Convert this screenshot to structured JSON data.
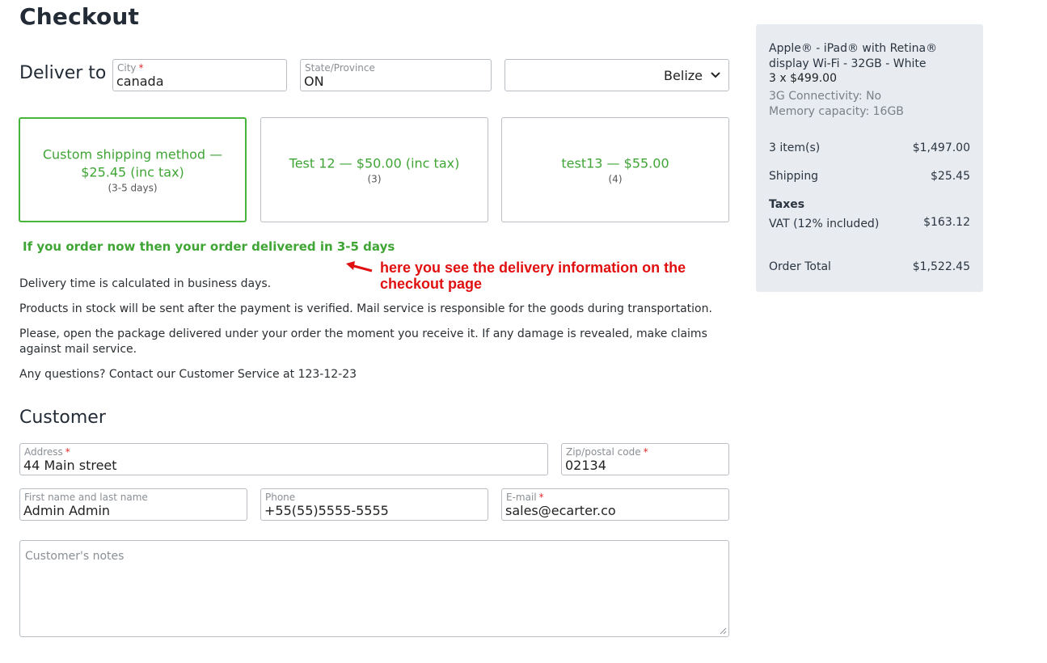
{
  "page": {
    "title": "Checkout"
  },
  "deliver": {
    "label": "Deliver to",
    "city": {
      "label": "City",
      "required": "*",
      "value": "canada"
    },
    "state": {
      "label": "State/Province",
      "value": "ON"
    },
    "country": {
      "value": "Belize"
    }
  },
  "shipping": [
    {
      "title": "Custom shipping method — $25.45 (inc tax)",
      "sub": "(3-5 days)",
      "selected": true
    },
    {
      "title": "Test 12 — $50.00 (inc tax)",
      "sub": "(3)",
      "selected": false
    },
    {
      "title": "test13 — $55.00",
      "sub": "(4)",
      "selected": false
    }
  ],
  "delivery_message": "If you order now then your order delivered in 3-5 days",
  "annotation": "here you see the delivery information on the checkout page",
  "info": [
    "Delivery time is calculated in business days.",
    "Products in stock will be sent after the payment is verified. Mail service is responsible for the goods during transportation.",
    "Please, open the package delivered under your order the moment you receive it. If any damage is revealed, make claims against mail service.",
    "Any questions? Contact our Customer Service at 123-12-23"
  ],
  "customer": {
    "heading": "Customer",
    "address": {
      "label": "Address",
      "required": "*",
      "value": "44 Main street"
    },
    "zip": {
      "label": "Zip/postal code",
      "required": "*",
      "value": "02134"
    },
    "name": {
      "label": "First name and last name",
      "value": "Admin Admin"
    },
    "phone": {
      "label": "Phone",
      "value": "+55(55)5555-5555"
    },
    "email": {
      "label": "E-mail",
      "required": "*",
      "value": "sales@ecarter.co"
    },
    "notes": {
      "placeholder": "Customer's notes"
    }
  },
  "summary": {
    "product_name": "Apple® - iPad® with Retina® display Wi-Fi - 32GB - White",
    "quantity_price": "3 x $499.00",
    "options": [
      "3G Connectivity: No",
      "Memory capacity: 16GB"
    ],
    "items_label": "3 item(s)",
    "items_value": "$1,497.00",
    "shipping_label": "Shipping",
    "shipping_value": "$25.45",
    "taxes_heading": "Taxes",
    "vat_label": "VAT (12% included)",
    "vat_value": "$163.12",
    "total_label": "Order Total",
    "total_value": "$1,522.45"
  },
  "colors": {
    "accent_green": "#46b53a",
    "annotation_red": "#e11010"
  },
  "icons": [
    "chevron-down-icon",
    "arrow-left-icon",
    "resize-grip-icon"
  ]
}
